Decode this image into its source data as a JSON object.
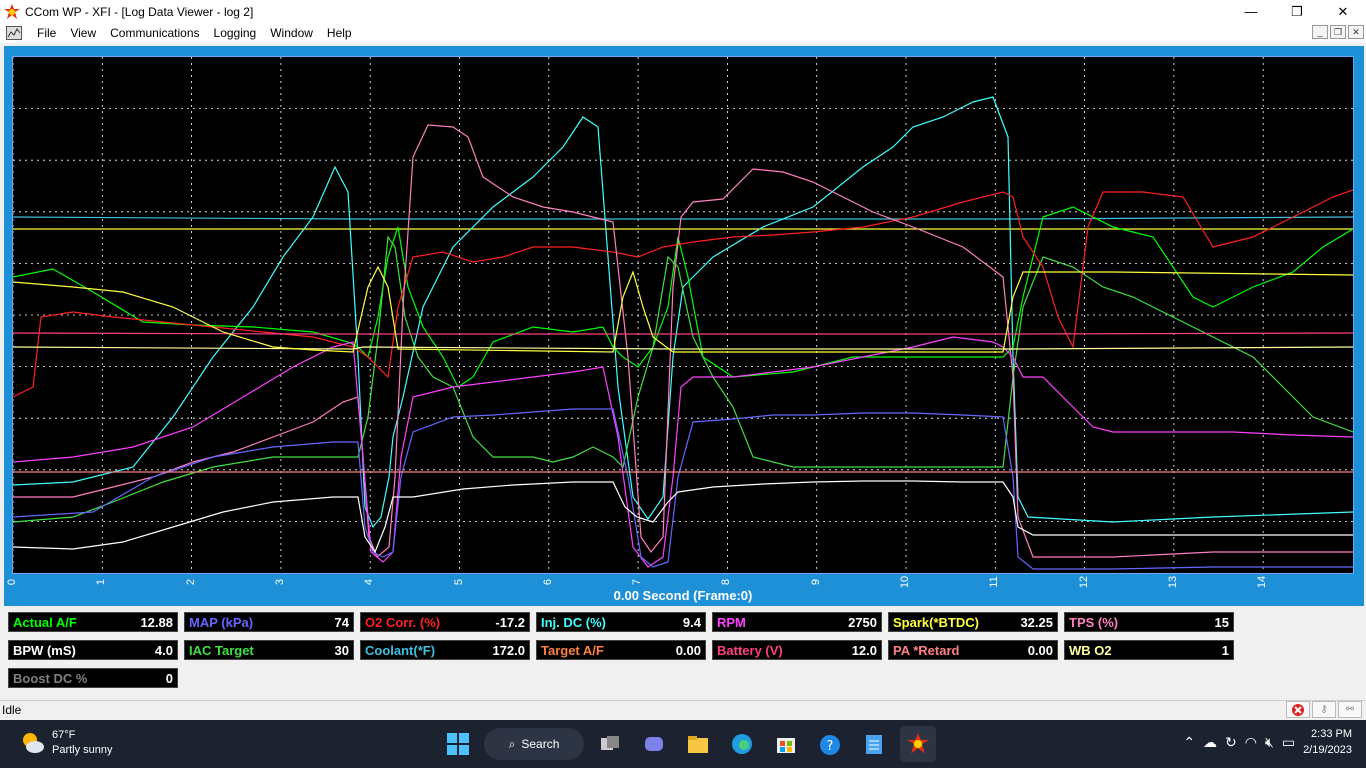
{
  "window": {
    "title": "CCom WP - XFI  - [Log Data Viewer - log 2]",
    "minimize": "—",
    "maximize": "❐",
    "close": "✕"
  },
  "menu": {
    "items": [
      "File",
      "View",
      "Communications",
      "Logging",
      "Window",
      "Help"
    ]
  },
  "chart": {
    "x_ticks": [
      "0",
      "1",
      "2",
      "3",
      "4",
      "5",
      "6",
      "7",
      "8",
      "9",
      "10",
      "11",
      "12",
      "13",
      "14"
    ],
    "frame_label": "0.00 Second (Frame:0)",
    "background": "#000000",
    "grid": true
  },
  "gauges": [
    {
      "label": "Actual A/F",
      "value": "12.88",
      "color": "#00ff00"
    },
    {
      "label": "MAP (kPa)",
      "value": "74",
      "color": "#6666ff"
    },
    {
      "label": "O2 Corr. (%)",
      "value": "-17.2",
      "color": "#ff2020"
    },
    {
      "label": "Inj. DC (%)",
      "value": "9.4",
      "color": "#40ffff"
    },
    {
      "label": "RPM",
      "value": "2750",
      "color": "#ff40ff"
    },
    {
      "label": "Spark(*BTDC)",
      "value": "32.25",
      "color": "#ffff40"
    },
    {
      "label": "TPS (%)",
      "value": "15",
      "color": "#ff80c0"
    },
    {
      "label": "BPW (mS)",
      "value": "4.0",
      "color": "#ffffff"
    },
    {
      "label": "IAC Target",
      "value": "30",
      "color": "#40e040"
    },
    {
      "label": "Coolant(*F)",
      "value": "172.0",
      "color": "#40c0e0"
    },
    {
      "label": "Target A/F",
      "value": "0.00",
      "color": "#ff8040"
    },
    {
      "label": "Battery (V)",
      "value": "12.0",
      "color": "#ff4080"
    },
    {
      "label": "PA *Retard",
      "value": "0.00",
      "color": "#ff8080"
    },
    {
      "label": "WB O2",
      "value": "1",
      "color": "#ffffa0"
    },
    {
      "label": "Boost DC %",
      "value": "0",
      "color": "#808080"
    }
  ],
  "status": {
    "text": "Idle"
  },
  "taskbar": {
    "weather_temp": "67°F",
    "weather_desc": "Partly sunny",
    "search_label": "Search",
    "time": "2:33 PM",
    "date": "2/19/2023"
  }
}
